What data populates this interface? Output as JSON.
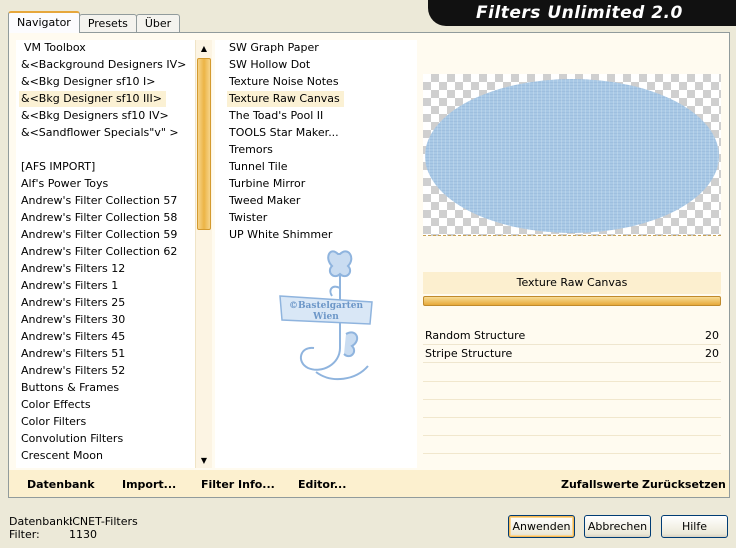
{
  "window": {
    "title": "Filters Unlimited 2.0"
  },
  "tabs": [
    {
      "label": "Navigator",
      "active": true
    },
    {
      "label": "Presets",
      "active": false
    },
    {
      "label": "Über",
      "active": false
    }
  ],
  "categories": {
    "items": [
      "VM Toolbox",
      "&<Background Designers IV>",
      "&<Bkg Designer sf10 I>",
      "&<Bkg Designer sf10 III>",
      "&<Bkg Designers sf10 IV>",
      "&<Sandflower Specials\"v\" >",
      "",
      "[AFS IMPORT]",
      "Alf's Power Toys",
      "Andrew's Filter Collection 57",
      "Andrew's Filter Collection 58",
      "Andrew's Filter Collection 59",
      "Andrew's Filter Collection 62",
      "Andrew's Filters 12",
      "Andrew's Filters 1",
      "Andrew's Filters 25",
      "Andrew's Filters 30",
      "Andrew's Filters 45",
      "Andrew's Filters 51",
      "Andrew's Filters 52",
      "Buttons & Frames",
      "Color Effects",
      "Color Filters",
      "Convolution Filters",
      "Crescent Moon"
    ],
    "selected_index": 3
  },
  "filters": {
    "items": [
      "SW Graph Paper",
      "SW Hollow Dot",
      "Texture Noise Notes",
      "Texture Raw Canvas",
      "The Toad's Pool II",
      "TOOLS Star Maker...",
      "Tremors",
      "Tunnel Tile",
      "Turbine Mirror",
      "Tweed Maker",
      "Twister",
      "UP White Shimmer"
    ],
    "selected_index": 3
  },
  "watermark": {
    "line1": "©Bastelgarten",
    "line2": "Wien"
  },
  "filter_panel": {
    "selected_name": "Texture Raw Canvas",
    "params": [
      {
        "name": "Random Structure",
        "value": "20"
      },
      {
        "name": "Stripe Structure",
        "value": "20"
      }
    ]
  },
  "bottom_links": {
    "datenbank": "Datenbank",
    "import": "Import...",
    "filter_info": "Filter Info...",
    "editor": "Editor...",
    "zufallswerte": "Zufallswerte",
    "zuruecksetzen": "Zurücksetzen"
  },
  "status": {
    "db_label": "Datenbank:",
    "db_value": "ICNET-Filters",
    "filter_label": "Filter:",
    "filter_value": "1130"
  },
  "buttons": {
    "apply": "Anwenden",
    "cancel": "Abbrechen",
    "help": "Hilfe"
  },
  "colors": {
    "accent": "#e6a73c",
    "preview_fill": "#a9c9e6",
    "header_band": "#111111"
  }
}
